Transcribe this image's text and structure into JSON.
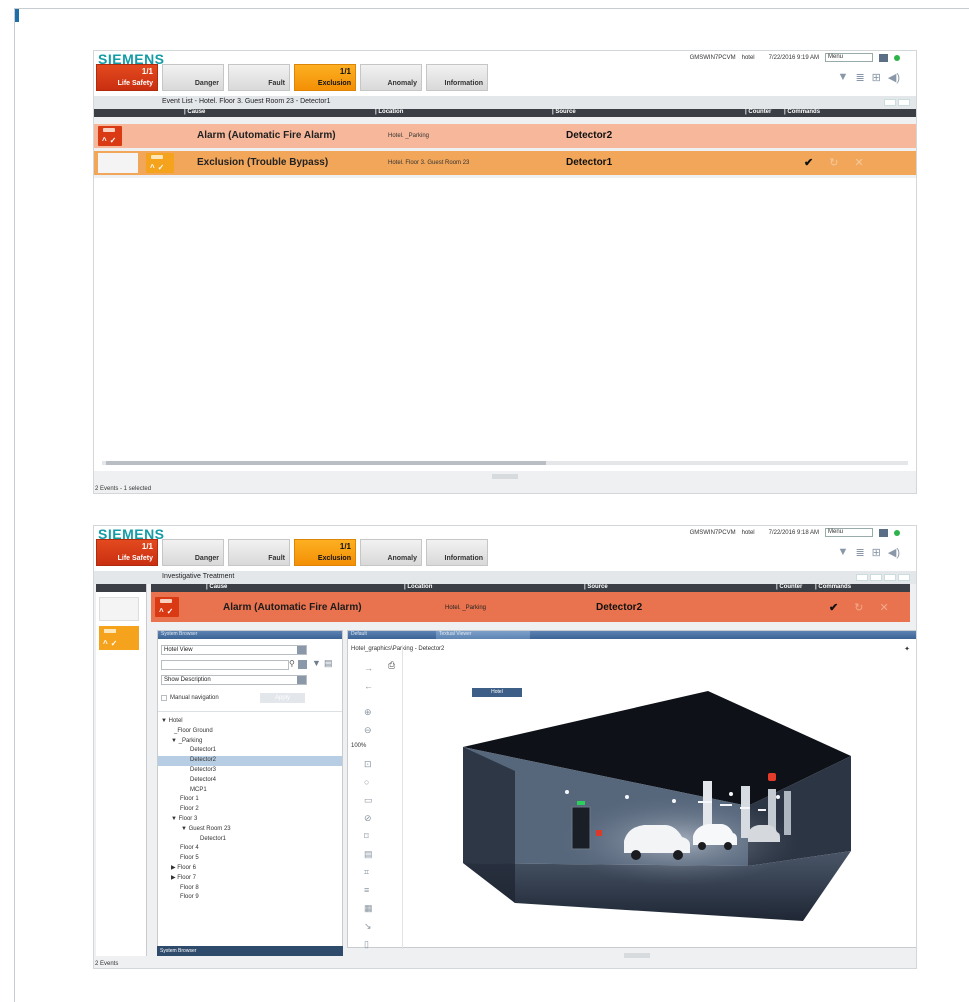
{
  "brand": "SIEMENS",
  "header": {
    "workstation": "GMSWIN7PCVM",
    "site": "hotel",
    "menu_label": "Menu"
  },
  "screen1": {
    "datetime": "7/22/2016  9:19 AM",
    "categories": [
      {
        "count": "1/1",
        "label": "Life Safety"
      },
      {
        "count": "",
        "label": "Danger"
      },
      {
        "count": "",
        "label": "Fault"
      },
      {
        "count": "1/1",
        "label": "Exclusion"
      },
      {
        "count": "",
        "label": "Anomaly"
      },
      {
        "count": "",
        "label": "Information"
      }
    ],
    "panel_title": "Event List - Hotel. Floor 3. Guest Room 23 - Detector1",
    "columns": {
      "cause": "Cause",
      "location": "Location",
      "source": "Source",
      "counter": "Counter",
      "commands": "Commands"
    },
    "events": [
      {
        "cause": "Alarm (Automatic Fire Alarm)",
        "location": "Hotel. _Parking",
        "source": "Detector2",
        "color": "#f6b79a"
      },
      {
        "cause": "Exclusion (Trouble Bypass)",
        "location": "Hotel. Floor 3. Guest Room 23",
        "source": "Detector1",
        "color": "#f2a65a"
      }
    ],
    "status": "2 Events - 1 selected"
  },
  "screen2": {
    "datetime": "7/22/2016  9:18 AM",
    "categories": [
      {
        "count": "1/1",
        "label": "Life Safety"
      },
      {
        "count": "",
        "label": "Danger"
      },
      {
        "count": "",
        "label": "Fault"
      },
      {
        "count": "1/1",
        "label": "Exclusion"
      },
      {
        "count": "",
        "label": "Anomaly"
      },
      {
        "count": "",
        "label": "Information"
      }
    ],
    "panel_title": "Investigative Treatment",
    "columns": {
      "cause": "Cause",
      "location": "Location",
      "source": "Source",
      "counter": "Counter",
      "commands": "Commands"
    },
    "event": {
      "cause": "Alarm (Automatic Fire Alarm)",
      "location": "Hotel. _Parking",
      "source": "Detector2"
    },
    "system_browser": {
      "title": "System Browser",
      "view": "Hotel View",
      "search_value": "",
      "description_mode": "Show Description",
      "manual_nav": "Manual navigation",
      "apply": "Apply",
      "tree": [
        "▼ Hotel",
        "_Floor Ground",
        "▼ _Parking",
        "Detector1",
        "Detector2",
        "Detector3",
        "Detector4",
        "MCP1",
        "Floor 1",
        "Floor 2",
        "▼ Floor 3",
        "▼ Guest Room 23",
        "Detector1",
        "Floor 4",
        "Floor 5",
        "▶ Floor 6",
        "▶ Floor 7",
        "Floor 8",
        "Floor 9"
      ],
      "footer": "System Browser"
    },
    "graphics": {
      "tab_default": "Default",
      "tab_textual": "Textual Viewer",
      "breadcrumb": "Hotel_graphics\\Parking  -  Detector2",
      "zoom": "100%",
      "hotel_button": "Hotel"
    },
    "status": "2 Events"
  }
}
